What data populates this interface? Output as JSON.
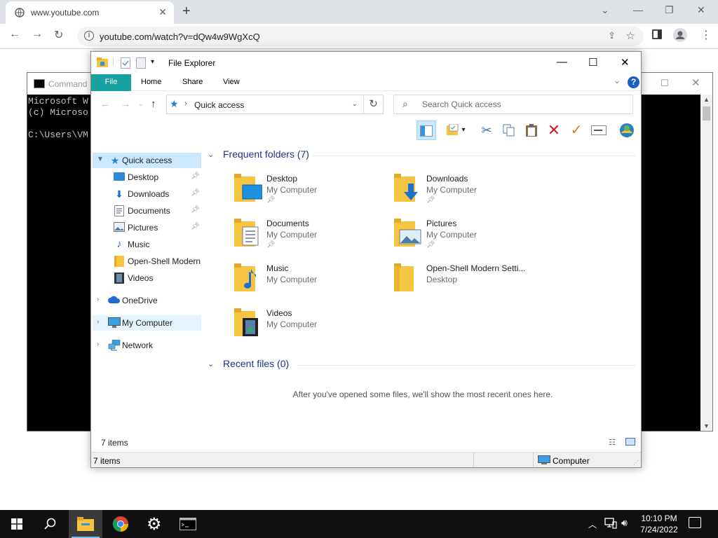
{
  "browser": {
    "tab_title": "www.youtube.com",
    "url": "youtube.com/watch?v=dQw4w9WgXcQ"
  },
  "cmd": {
    "title": "Command",
    "lines": [
      "Microsoft W",
      "(c) Microso",
      "",
      "C:\\Users\\VM"
    ]
  },
  "explorer": {
    "title": "File Explorer",
    "ribbon_tabs": {
      "file": "File",
      "home": "Home",
      "share": "Share",
      "view": "View"
    },
    "help": "?",
    "address": "Quick access",
    "search_placeholder": "Search Quick access",
    "nav": {
      "quick_access": "Quick access",
      "desktop": "Desktop",
      "downloads": "Downloads",
      "documents": "Documents",
      "pictures": "Pictures",
      "music": "Music",
      "openshell": "Open-Shell Modern",
      "videos": "Videos",
      "onedrive": "OneDrive",
      "my_computer": "My Computer",
      "network": "Network"
    },
    "frequent_header": "Frequent folders (7)",
    "folders": [
      {
        "name": "Desktop",
        "location": "My Computer"
      },
      {
        "name": "Downloads",
        "location": "My Computer"
      },
      {
        "name": "Documents",
        "location": "My Computer"
      },
      {
        "name": "Pictures",
        "location": "My Computer"
      },
      {
        "name": "Music",
        "location": "My Computer"
      },
      {
        "name": "Open-Shell Modern Setti...",
        "location": "Desktop"
      },
      {
        "name": "Videos",
        "location": "My Computer"
      }
    ],
    "recent_header": "Recent files (0)",
    "recent_empty": "After you've opened some files, we'll show the most recent ones here.",
    "status_items": "7 items",
    "status_items_2": "7 items",
    "status_location": "Computer"
  },
  "taskbar": {
    "time": "10:10 PM",
    "date": "7/24/2022"
  },
  "colors": {
    "ribbon_file": "#19a1a1",
    "folder_yellow": "#f5c542",
    "section_header": "#1e3287",
    "selection": "#cce8ff",
    "taskbar": "#101010"
  }
}
